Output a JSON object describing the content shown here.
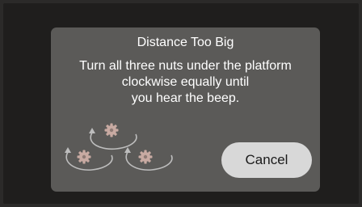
{
  "dialog": {
    "title": "Distance Too Big",
    "message_lines": [
      "Turn all three nuts under the platform",
      "clockwise equally until",
      "you hear the beep."
    ],
    "cancel_label": "Cancel"
  },
  "icons": {
    "illustration": "three-nuts-clockwise-icon"
  },
  "colors": {
    "dialog_bg": "#5b5a58",
    "button_bg": "#d8d8d8",
    "nut": "#c8aaa2",
    "arrow": "#bdbdbd"
  }
}
